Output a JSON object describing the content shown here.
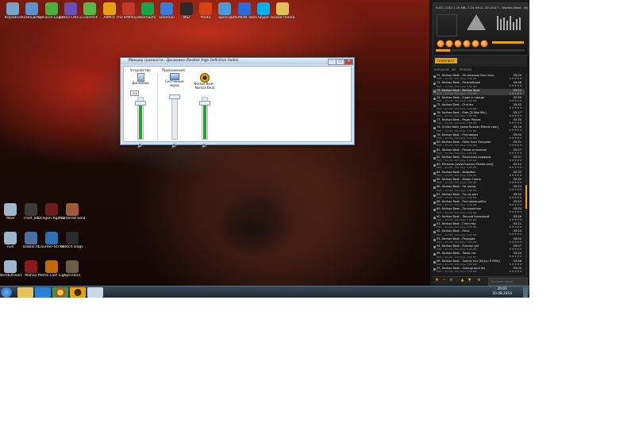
{
  "desktop": {
    "top_icons": [
      {
        "label": "Корзина",
        "color": "#7aa2c8"
      },
      {
        "label": "Компьютер",
        "color": "#5e8fd0"
      },
      {
        "label": "GeForce Experience",
        "color": "#4caf3f"
      },
      {
        "label": "CRUD CPU-Z",
        "color": "#6a4fb5"
      },
      {
        "label": "uTorrent",
        "color": "#57b843"
      },
      {
        "label": "AIMP3",
        "color": "#e8a013"
      },
      {
        "label": "The KMPlayer",
        "color": "#c0392b"
      },
      {
        "label": "Hamachi",
        "color": "#1aa34a"
      },
      {
        "label": "Daemon",
        "color": "#3a7bd5"
      },
      {
        "label": "MSI",
        "color": "#2a2a2a"
      },
      {
        "label": "Photo",
        "color": "#d84315"
      },
      {
        "label": "Speccy",
        "color": "#4a9bd9"
      },
      {
        "label": "DAEMON Tools Lite",
        "color": "#2f6bd8"
      },
      {
        "label": "Skype",
        "color": "#00aff0"
      },
      {
        "label": "Новая папка",
        "color": "#e0c25a"
      }
    ],
    "left_icons": [
      {
        "label": "Mod",
        "color": "#9db6cc"
      },
      {
        "label": "Thief_84",
        "color": "#3a3a3a"
      },
      {
        "label": "Dragon Age Origins",
        "color": "#6b1d1d"
      },
      {
        "label": "Murdered Soul Suspect",
        "color": "#a05a3a"
      },
      {
        "label": "null",
        "color": "#9db6cc"
      },
      {
        "label": "Diablo III",
        "color": "#4a6fa0"
      },
      {
        "label": "Counter-Strike 1.6",
        "color": "#2f6fb0"
      },
      {
        "label": "Watch Dogs",
        "color": "#2a2a2a"
      },
      {
        "label": "WorldOfTools",
        "color": "#9db6cc"
      },
      {
        "label": "Mafia2",
        "color": "#8a1a1a"
      },
      {
        "label": "Metro Last Light",
        "color": "#c06a10"
      },
      {
        "label": "Sprinters",
        "color": "#6a5a4a"
      }
    ]
  },
  "mixer": {
    "title": "Микшер громкости - Динамики (Realtek High Definition Audio)",
    "section_device": "Устройство",
    "section_apps": "Приложения",
    "level_tooltip": "100",
    "channels": [
      {
        "name": "Динамики",
        "level": 0.85
      },
      {
        "name": "Системные звуки",
        "level": 0.0
      },
      {
        "name": "Norkox Beat - Norkox Beat",
        "level": 0.85
      }
    ]
  },
  "aimp": {
    "header": "0:03 / 0:52 1.19 MB, 7:24 min",
    "track": "1. 00:14:27 :: Norkox Beat - (6)",
    "tabs": [
      "ПЛЕЙЛИСТ"
    ],
    "subtabs": [
      "ВНЕШНИЕ",
      "3D",
      "РЕЛИЗЫ"
    ],
    "playlist": [
      {
        "title": "71. Norkox Beat - Не можешь был ночь",
        "dur": "03:00"
      },
      {
        "title": "72. Norkox Beat - Нежнейшая",
        "dur": "04:46"
      },
      {
        "title": "73. Norkox Beat - Norkox Beat",
        "dur": "03:22"
      },
      {
        "title": "74. Norkox Beat - Один в городе",
        "dur": "02:30"
      },
      {
        "title": "75. Norkox Beat - Огонек",
        "dur": "03:32"
      },
      {
        "title": "76. Norkox Beat - Ride [D-Nox Mix]",
        "dur": "03:27"
      },
      {
        "title": "77. Norkox Beat - Paper Planes",
        "dur": "03:30"
      },
      {
        "title": "78. Chiller Baby [www.Russian-Pleeds.com]",
        "dur": "03:14"
      },
      {
        "title": "79. Norkox Beat - Разговоры",
        "dur": "03:00"
      },
      {
        "title": "80. Norkox Beat - Hello from Gangster",
        "dur": "03:31"
      },
      {
        "title": "81. Norkox Beat - Разом и полным",
        "dur": "03:27"
      },
      {
        "title": "82. Norkox Beat - Мальчики кадавры",
        "dur": "03:37"
      },
      {
        "title": "83. Personal [www.Russian-Pleeds.com]",
        "dur": "03:12"
      },
      {
        "title": "84. Norkox Beat - Инфобос",
        "dur": "02:32"
      },
      {
        "title": "85. Norkox Beat - Мамы Ганна",
        "dur": "03:32"
      },
      {
        "title": "86. Norkox Beat - На заход",
        "dur": "03:23"
      },
      {
        "title": "87. Norkox Beat - Ты ты дон",
        "dur": "03:32"
      },
      {
        "title": "88. Norkox Beat - Разгорающийся",
        "dur": "03:22"
      },
      {
        "title": "89. Norkox Beat - Потерянные",
        "dur": "03:53"
      },
      {
        "title": "90. Norkox Beat - Легкий Холодный",
        "dur": "03:26"
      },
      {
        "title": "91. Norkox Beat - Гангстер",
        "dur": "03:21"
      },
      {
        "title": "92. Norkox Beat - Ночь",
        "dur": "03:14"
      },
      {
        "title": "93. Norkox Beat - Рецидив",
        "dur": "03:02"
      },
      {
        "title": "94. Norkox Beat - Russian girl",
        "dur": "03:07"
      },
      {
        "title": "95. Norkox Beat - Лама нас",
        "dur": "03:40"
      },
      {
        "title": "96. Norkox Beat - Sabrey fixx [DJ Juu P RMX]",
        "dur": "03:46"
      },
      {
        "title": "97. Norkox Beat - Samogi boul leo",
        "dur": "03:02"
      }
    ],
    "meta": "MP3 :: 44 kHz, 320 kbps, 5,86 MB",
    "rating": "★★★★★",
    "quick_search": "Быстрый поиск"
  },
  "taskbar": {
    "time": "20:01",
    "date": "20.08.2014"
  },
  "colors": {
    "accent": "#e8a013",
    "volume_fill": "#2ca02c"
  }
}
